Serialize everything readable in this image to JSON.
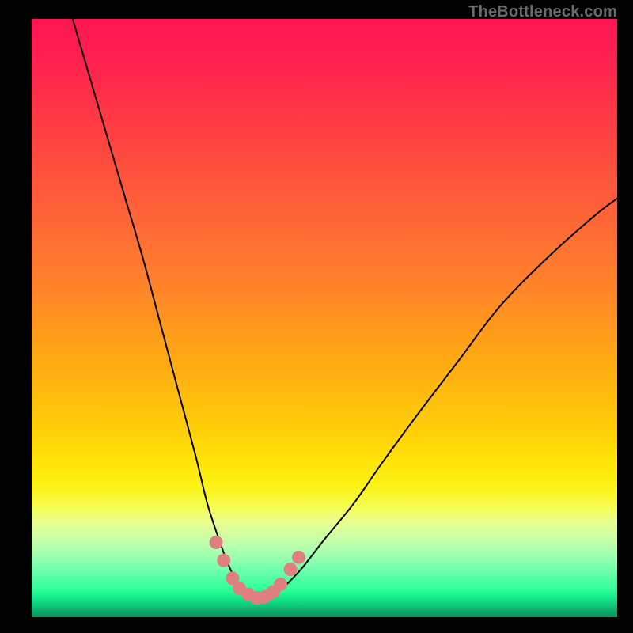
{
  "watermark": "TheBottleneck.com",
  "colors": {
    "frame": "#000000",
    "curve": "#000000",
    "dots_fill": "#e07f7f",
    "dots_stroke": "#c76868",
    "watermark_text": "#6b6b6b",
    "gradient_top": "#ff1552",
    "gradient_mid": "#ffd008",
    "gradient_bottom": "#089860"
  },
  "chart_data": {
    "type": "line",
    "title": "",
    "xlabel": "",
    "ylabel": "",
    "xlim": [
      0,
      100
    ],
    "ylim": [
      0,
      100
    ],
    "grid": false,
    "legend": false,
    "series": [
      {
        "name": "bottleneck-curve",
        "x": [
          7,
          10,
          13,
          16,
          19,
          22,
          25,
          28,
          30,
          32,
          33.5,
          35,
          36.5,
          38,
          39.5,
          41,
          43,
          46,
          50,
          55,
          60,
          66,
          73,
          80,
          88,
          96,
          100
        ],
        "y": [
          100,
          90,
          80,
          70,
          60,
          49,
          38,
          27,
          19,
          13,
          9,
          6,
          4,
          3,
          3,
          3.5,
          5,
          8,
          13,
          19,
          26,
          34,
          43,
          52,
          60,
          67,
          70
        ]
      }
    ],
    "annotations": {
      "trough_dots": {
        "name": "highlighted-points-near-minimum",
        "x": [
          31.5,
          32.8,
          34.3,
          35.5,
          37.0,
          38.5,
          39.8,
          41.2,
          42.5,
          44.2,
          45.6
        ],
        "y": [
          12.5,
          9.5,
          6.5,
          4.8,
          3.8,
          3.2,
          3.4,
          4.2,
          5.5,
          8.0,
          10.0
        ]
      }
    },
    "description": "V-shaped bottleneck curve over a vertical rainbow heat gradient. Curve minimum is around x≈37–39 with y≈3. Left branch is steeper than right branch. Salmon-colored dots highlight the samples sitting in the green trough region."
  }
}
